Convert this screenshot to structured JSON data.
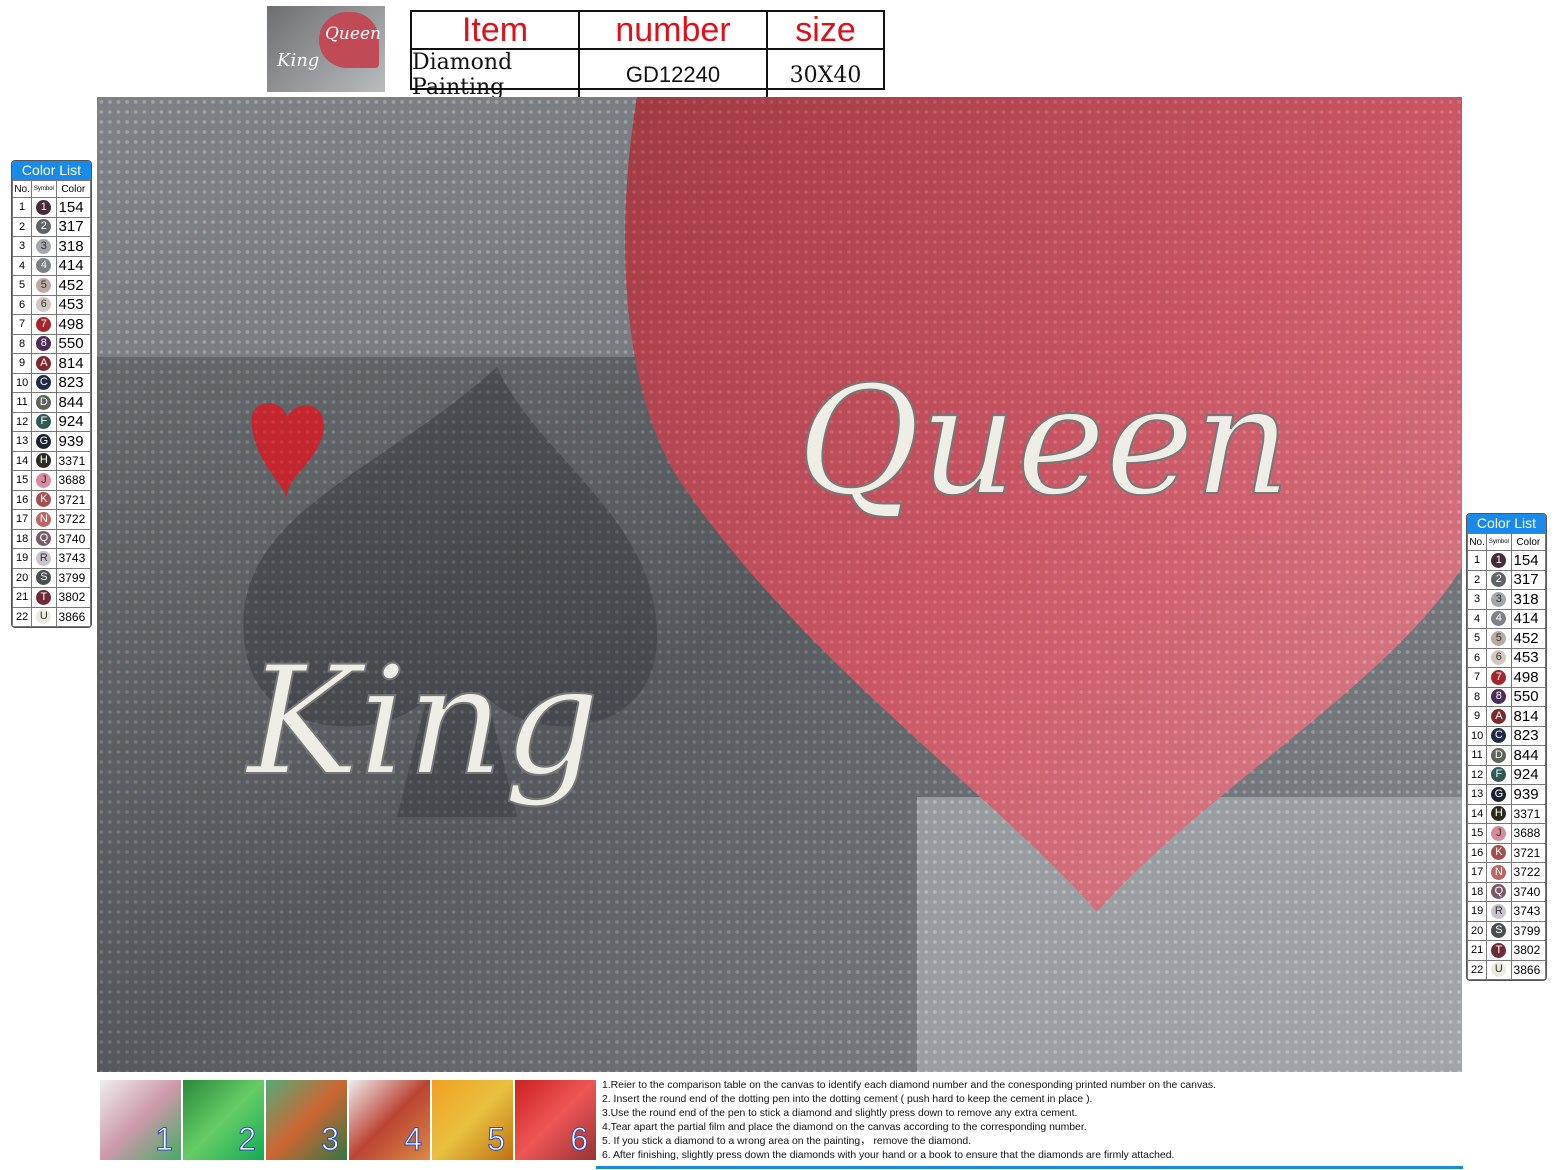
{
  "header": {
    "thumbnail_text": {
      "queen": "Queen",
      "king": "King"
    },
    "columns": [
      "Item",
      "number",
      "size"
    ],
    "values": [
      "Diamond Painting",
      "GD12240",
      "30X40"
    ]
  },
  "artwork": {
    "queen_text": "Queen",
    "king_text": "King",
    "heart_color": "#c04a55",
    "background_color": "#5d6064"
  },
  "legend": {
    "title": "Color List",
    "headers": [
      "No.",
      "Symbol",
      "Color"
    ],
    "rows": [
      {
        "no": "1",
        "symbol": "1",
        "color": "154",
        "hex": "#4a2a3a"
      },
      {
        "no": "2",
        "symbol": "2",
        "color": "317",
        "hex": "#5f6466"
      },
      {
        "no": "3",
        "symbol": "3",
        "color": "318",
        "hex": "#a3a8ad"
      },
      {
        "no": "4",
        "symbol": "4",
        "color": "414",
        "hex": "#7d8286"
      },
      {
        "no": "5",
        "symbol": "5",
        "color": "452",
        "hex": "#bcaaa4"
      },
      {
        "no": "6",
        "symbol": "6",
        "color": "453",
        "hex": "#d2c8c2"
      },
      {
        "no": "7",
        "symbol": "7",
        "color": "498",
        "hex": "#a4262b"
      },
      {
        "no": "8",
        "symbol": "8",
        "color": "550",
        "hex": "#4d2a5a"
      },
      {
        "no": "9",
        "symbol": "A",
        "color": "814",
        "hex": "#7a2a2e"
      },
      {
        "no": "10",
        "symbol": "C",
        "color": "823",
        "hex": "#1f2a48"
      },
      {
        "no": "11",
        "symbol": "D",
        "color": "844",
        "hex": "#5f6458"
      },
      {
        "no": "12",
        "symbol": "F",
        "color": "924",
        "hex": "#2f5a55"
      },
      {
        "no": "13",
        "symbol": "G",
        "color": "939",
        "hex": "#1c2330"
      },
      {
        "no": "14",
        "symbol": "H",
        "color": "3371",
        "hex": "#2d2a1e"
      },
      {
        "no": "15",
        "symbol": "J",
        "color": "3688",
        "hex": "#d88aa0"
      },
      {
        "no": "16",
        "symbol": "K",
        "color": "3721",
        "hex": "#a55050"
      },
      {
        "no": "17",
        "symbol": "N",
        "color": "3722",
        "hex": "#b86666"
      },
      {
        "no": "18",
        "symbol": "Q",
        "color": "3740",
        "hex": "#7a5a6a"
      },
      {
        "no": "19",
        "symbol": "R",
        "color": "3743",
        "hex": "#cac2cc"
      },
      {
        "no": "20",
        "symbol": "S",
        "color": "3799",
        "hex": "#4a5050"
      },
      {
        "no": "21",
        "symbol": "T",
        "color": "3802",
        "hex": "#6e2a38"
      },
      {
        "no": "22",
        "symbol": "U",
        "color": "3866",
        "hex": "#ecebe0"
      }
    ]
  },
  "steps": [
    "1",
    "2",
    "3",
    "4",
    "5",
    "6"
  ],
  "instructions": [
    "1.Reier to the comparison table on the canvas to identify each diamond number and the conesponding printed number on the canvas.",
    "2. Insert the round end of the dotting pen into the dotting cement ( push hard to keep the cement in place ).",
    "3.Use the round end of the pen to stick a diamond and slightly press down to remove any extra cement.",
    "4.Tear apart the partial film and place the diamond on the canvas according to the corresponding number.",
    "5. If you stick a diamond to a wrong area on the painting，  remove the diamond.",
    "6. After finishing, slightly press down the diamonds with your hand or a book to ensure that the diamonds are firmly attached."
  ]
}
